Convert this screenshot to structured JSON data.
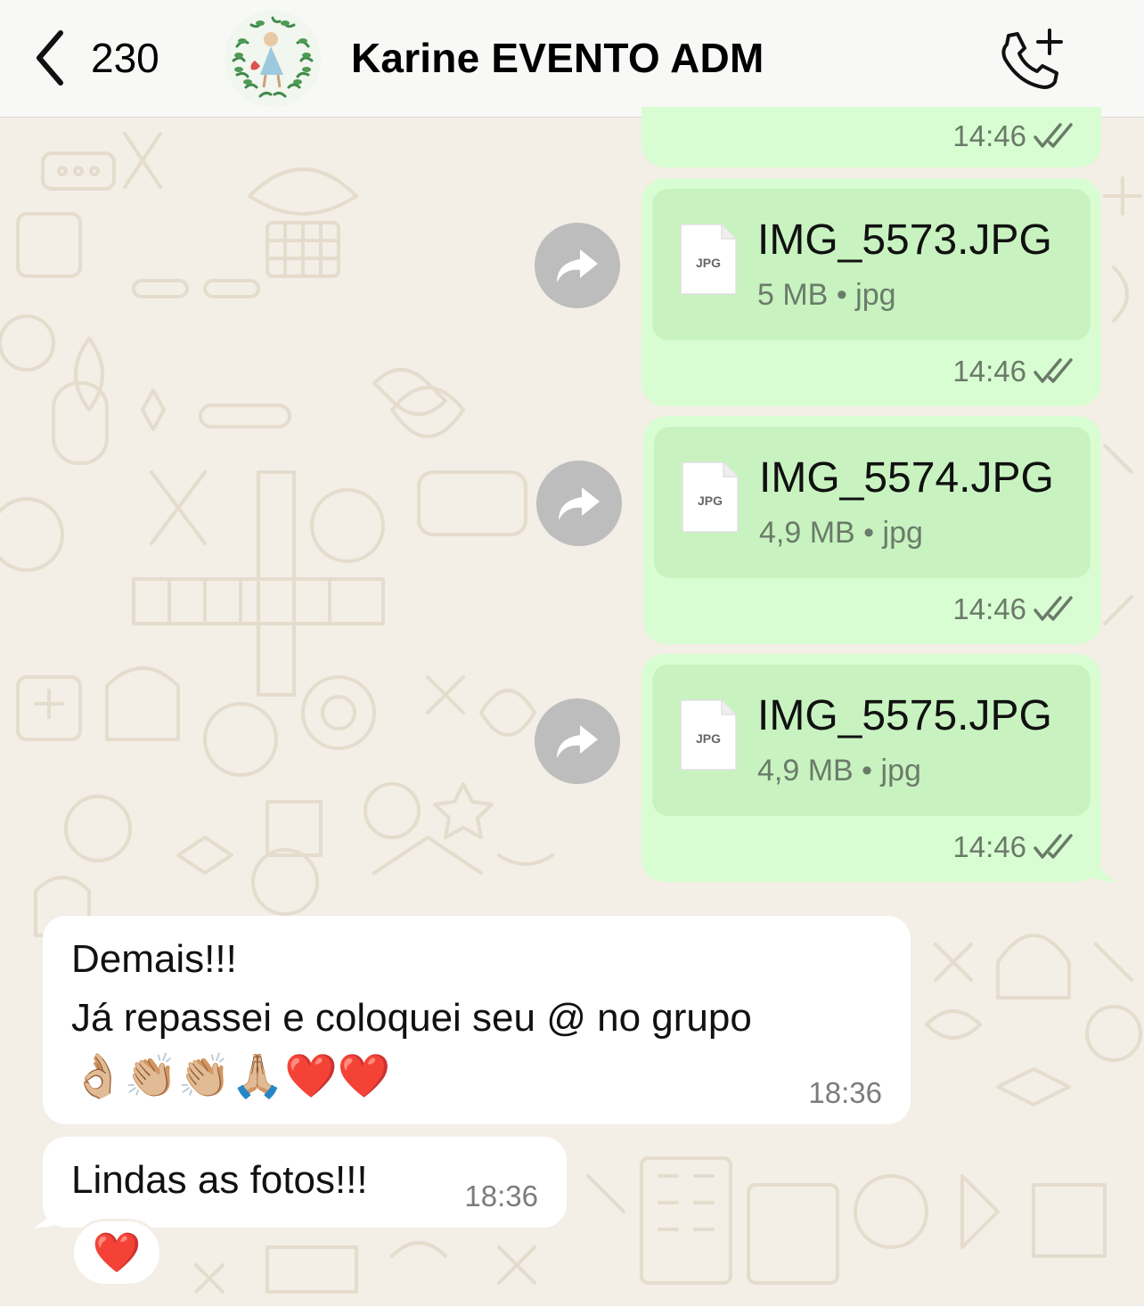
{
  "header": {
    "back_count": "230",
    "contact_name": "Karine EVENTO ADM"
  },
  "messages_out": [
    {
      "time": "14:46"
    },
    {
      "file_name": "IMG_5573.JPG",
      "size": "5 MB",
      "ext": "jpg",
      "icon_label": "JPG",
      "time": "14:46"
    },
    {
      "file_name": "IMG_5574.JPG",
      "size": "4,9 MB",
      "ext": "jpg",
      "icon_label": "JPG",
      "time": "14:46"
    },
    {
      "file_name": "IMG_5575.JPG",
      "size": "4,9 MB",
      "ext": "jpg",
      "icon_label": "JPG",
      "time": "14:46"
    }
  ],
  "meta_separator": "•",
  "messages_in": [
    {
      "line1": "Demais!!!",
      "line2": "Já repassei e coloquei seu @ no grupo",
      "line3": "👌🏼👏🏼👏🏼🙏🏼❤️❤️",
      "time": "18:36"
    },
    {
      "text": "Lindas as fotos!!!",
      "time": "18:36",
      "reaction": "❤️"
    }
  ],
  "icons": {
    "back": "chevron-left-icon",
    "call": "phone-add-icon",
    "forward": "forward-arrow-icon",
    "read": "double-check-icon",
    "document": "jpg-file-icon"
  },
  "colors": {
    "outgoing_bubble": "#d9fdd3",
    "doc_card": "#c8f3c0",
    "incoming_bubble": "#ffffff",
    "read_ticks": "#6a7a68"
  }
}
